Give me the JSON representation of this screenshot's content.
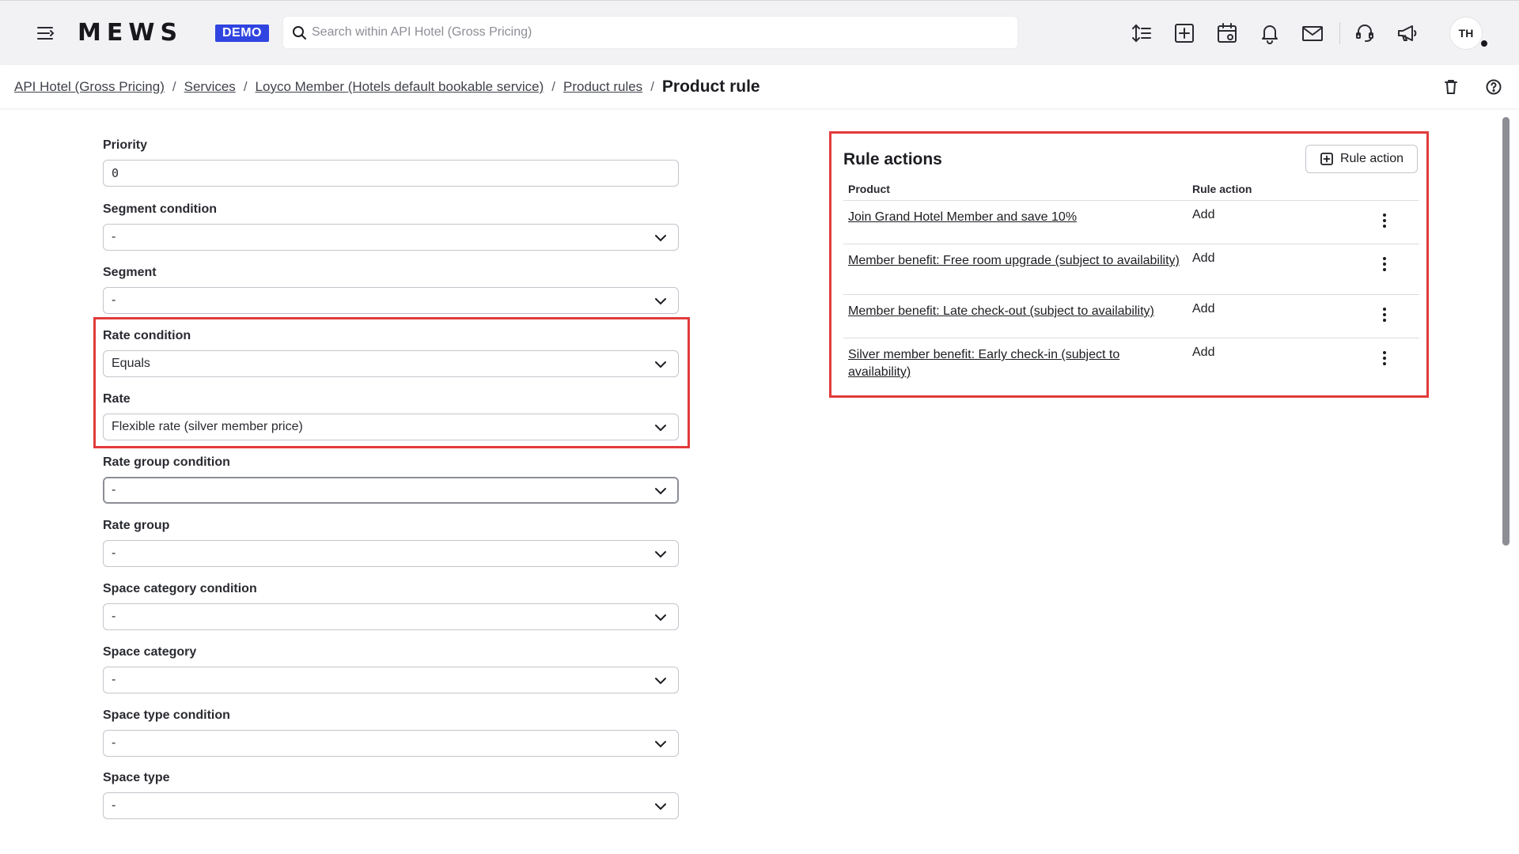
{
  "header": {
    "logo": "MEWS",
    "badge": "DEMO",
    "search_placeholder": "Search within API Hotel (Gross Pricing)",
    "avatar_initials": "TH"
  },
  "breadcrumb": {
    "items": [
      "API Hotel (Gross Pricing)",
      "Services",
      "Loyco Member (Hotels default bookable service)",
      "Product rules"
    ],
    "separator": "/",
    "current": "Product rule"
  },
  "form": {
    "priority": {
      "label": "Priority",
      "value": "0"
    },
    "segment_condition": {
      "label": "Segment condition",
      "value": "-"
    },
    "segment": {
      "label": "Segment",
      "value": "-"
    },
    "rate_condition": {
      "label": "Rate condition",
      "value": "Equals"
    },
    "rate": {
      "label": "Rate",
      "value": "Flexible rate (silver member price)"
    },
    "rate_group_condition": {
      "label": "Rate group condition",
      "value": "-"
    },
    "rate_group": {
      "label": "Rate group",
      "value": "-"
    },
    "space_category_condition": {
      "label": "Space category condition",
      "value": "-"
    },
    "space_category": {
      "label": "Space category",
      "value": "-"
    },
    "space_type_condition": {
      "label": "Space type condition",
      "value": "-"
    },
    "space_type": {
      "label": "Space type",
      "value": "-"
    }
  },
  "rule_actions": {
    "title": "Rule actions",
    "add_button": "Rule action",
    "columns": {
      "product": "Product",
      "rule_action": "Rule action"
    },
    "rows": [
      {
        "product": "Join Grand Hotel Member and save 10%",
        "action": "Add"
      },
      {
        "product": "Member benefit: Free room upgrade (subject to availability)",
        "action": "Add"
      },
      {
        "product": "Member benefit: Late check-out (subject to availability)",
        "action": "Add"
      },
      {
        "product": "Silver member benefit: Early check-in (subject to availability)",
        "action": "Add"
      }
    ]
  },
  "colors": {
    "accent": "#3045e0",
    "highlight": "#e23b3b",
    "topbar": "#f2f2f4"
  }
}
